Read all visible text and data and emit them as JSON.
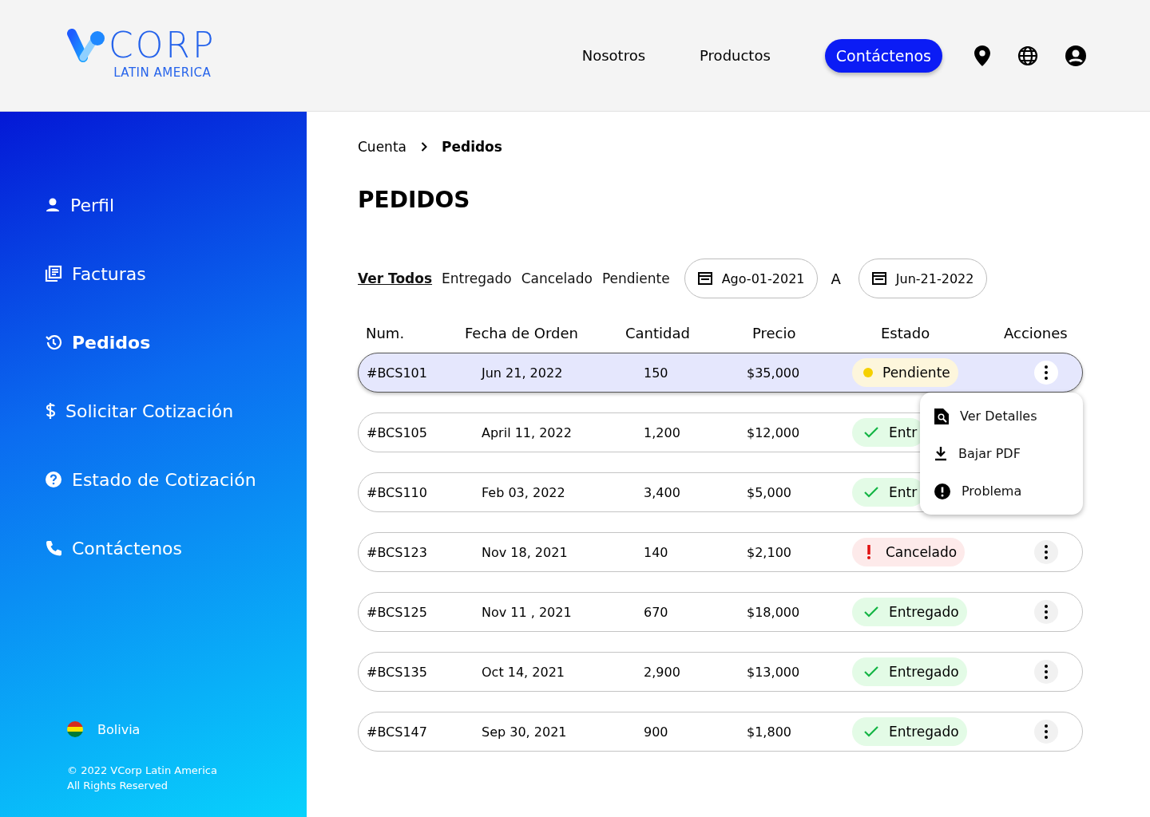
{
  "header": {
    "logo": {
      "brand": "CORP",
      "tagline": "LATIN AMERICA"
    },
    "nav": [
      {
        "label": "Nosotros",
        "kind": "link"
      },
      {
        "label": "Productos",
        "kind": "link"
      },
      {
        "label": "Contáctenos",
        "kind": "button"
      }
    ]
  },
  "sidebar": {
    "items": [
      {
        "label": "Perfil",
        "selected": false
      },
      {
        "label": "Facturas",
        "selected": false
      },
      {
        "label": "Pedidos",
        "selected": true
      },
      {
        "label": "Solicitar Cotización",
        "selected": false
      },
      {
        "label": "Estado de Cotización",
        "selected": false
      },
      {
        "label": "Contáctenos",
        "selected": false
      }
    ],
    "country": "Bolivia",
    "copyright": [
      "© 2022 VCorp Latin America",
      "All Rights Reserved"
    ]
  },
  "breadcrumb": [
    {
      "label": "Cuenta",
      "current": false
    },
    {
      "label": "Pedidos",
      "current": true
    }
  ],
  "title": "PEDIDOS",
  "filters": [
    {
      "label": "Ver Todos",
      "selected": true
    },
    {
      "label": "Entregado",
      "selected": false
    },
    {
      "label": "Cancelado",
      "selected": false
    },
    {
      "label": "Pendiente",
      "selected": false
    }
  ],
  "date_from": "Ago-01-2021",
  "date_separator": "A",
  "date_to": "Jun-21-2022",
  "table": {
    "columns": [
      "Num.",
      "Fecha de Orden",
      "Cantidad",
      "Precio",
      "Estado",
      "Acciones"
    ],
    "rows": [
      {
        "num": "#BCS101",
        "date": "Jun 21, 2022",
        "qty": "150",
        "price": "$35,000",
        "status": "Pendiente",
        "kind": "pending",
        "selected": true,
        "menu_open": true
      },
      {
        "num": "#BCS105",
        "date": "April 11, 2022",
        "qty": "1,200",
        "price": "$12,000",
        "status": "Entr",
        "kind": "delivered",
        "selected": false,
        "menu_open": false
      },
      {
        "num": "#BCS110",
        "date": "Feb 03, 2022",
        "qty": "3,400",
        "price": "$5,000",
        "status": "Entr",
        "kind": "delivered",
        "selected": false,
        "menu_open": false
      },
      {
        "num": "#BCS123",
        "date": "Nov 18, 2021",
        "qty": "140",
        "price": "$2,100",
        "status": "Cancelado",
        "kind": "cancelled",
        "selected": false,
        "menu_open": false
      },
      {
        "num": "#BCS125",
        "date": "Nov 11 , 2021",
        "qty": "670",
        "price": "$18,000",
        "status": "Entregado",
        "kind": "delivered",
        "selected": false,
        "menu_open": false
      },
      {
        "num": "#BCS135",
        "date": "Oct 14, 2021",
        "qty": "2,900",
        "price": "$13,000",
        "status": "Entregado",
        "kind": "delivered",
        "selected": false,
        "menu_open": false
      },
      {
        "num": "#BCS147",
        "date": "Sep 30, 2021",
        "qty": "900",
        "price": "$1,800",
        "status": "Entregado",
        "kind": "delivered",
        "selected": false,
        "menu_open": false
      }
    ]
  },
  "action_menu": {
    "items": [
      {
        "label": "Ver Detalles"
      },
      {
        "label": "Bajar PDF"
      },
      {
        "label": "Problema"
      }
    ]
  }
}
